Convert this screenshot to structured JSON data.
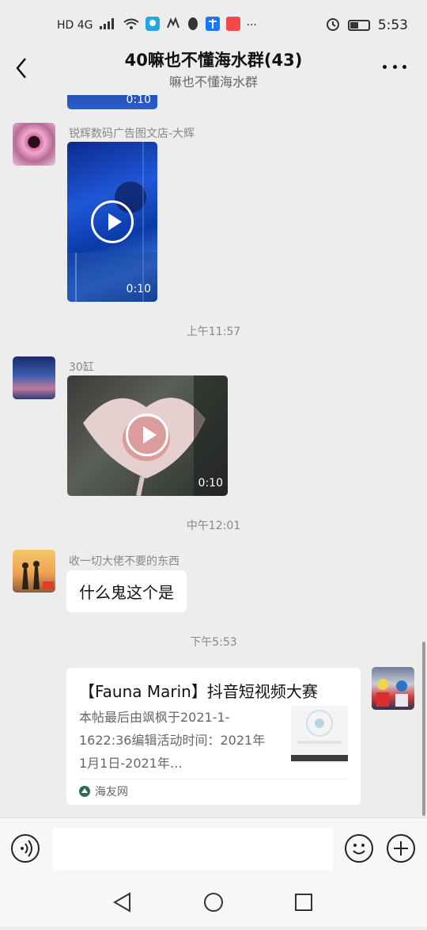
{
  "status_bar": {
    "network": "HD 4G",
    "time": "5:53"
  },
  "nav": {
    "title": "40嘛也不懂海水群(43)",
    "subtitle": "嘛也不懂海水群"
  },
  "messages": [
    {
      "type": "video",
      "duration": "0:10"
    },
    {
      "type": "video",
      "sender": "锐辉数码广告图文店-大辉",
      "duration": "0:10"
    },
    {
      "type": "time",
      "text": "上午11:57"
    },
    {
      "type": "video",
      "sender": "30缸",
      "duration": "0:10"
    },
    {
      "type": "time",
      "text": "中午12:01"
    },
    {
      "type": "text",
      "sender": "收一切大佬不要的东西",
      "text": "什么鬼这个是"
    },
    {
      "type": "time",
      "text": "下午5:53"
    },
    {
      "type": "link_card",
      "title": "【Fauna Marin】抖音短视频大赛",
      "description": "本帖最后由飒枫于2021-1-1622:36编辑活动时间：2021年1月1日-2021年…",
      "source": "海友网"
    }
  ],
  "input": {
    "placeholder": ""
  },
  "colors": {
    "background": "#ededed",
    "bubble": "#ffffff",
    "source_icon": "#2e6b5a"
  }
}
